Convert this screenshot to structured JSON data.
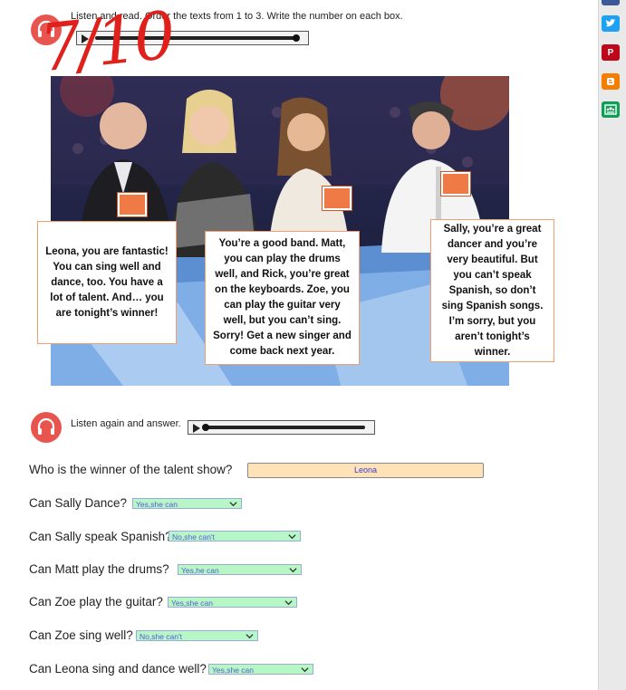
{
  "instructions": {
    "first": "Listen and read. Order the texts from 1 to 3. Write the number on each box.",
    "second": "Listen again and answer."
  },
  "score": "7/10",
  "bubbles": {
    "left": "Leona, you are fantastic! You can sing well and dance, too. You have a lot of talent. And… you are tonight’s winner!",
    "middle": "You’re a good band. Matt, you can play the drums well, and Rick, you’re great on the keyboards. Zoe, you can play the guitar very well, but you can’t sing. Sorry! Get a new singer and come back next year.",
    "right": "Sally, you’re a great dancer and you’re very beautiful. But you can’t speak Spanish, so don’t sing Spanish songs. I’m sorry, but you aren’t tonight’s winner."
  },
  "questions": [
    {
      "label": "Who is the winner of the talent show?",
      "answer": "Leona"
    },
    {
      "label": "Can Sally Dance?",
      "answer": "Yes,she can"
    },
    {
      "label": "Can Sally speak Spanish?",
      "answer": "No,she can't"
    },
    {
      "label": "Can Matt play the drums?",
      "answer": "Yes,he can"
    },
    {
      "label": "Can Zoe play the guitar?",
      "answer": "Yes,she can"
    },
    {
      "label": "Can Zoe sing well?",
      "answer": "No,she can't"
    },
    {
      "label": "Can Leona sing and dance well?",
      "answer": "Yes,she can"
    }
  ],
  "share_icons": [
    "facebook-icon",
    "twitter-icon",
    "pinterest-icon",
    "blogger-icon",
    "classroom-icon"
  ],
  "colors": {
    "headphone": "#e8554f",
    "score": "#e0201a",
    "text_answer_bg": "#ffe2b8",
    "select_bg": "#b6f7c5",
    "bubble_border": "#f0a070",
    "number_box": "#f07a45"
  }
}
